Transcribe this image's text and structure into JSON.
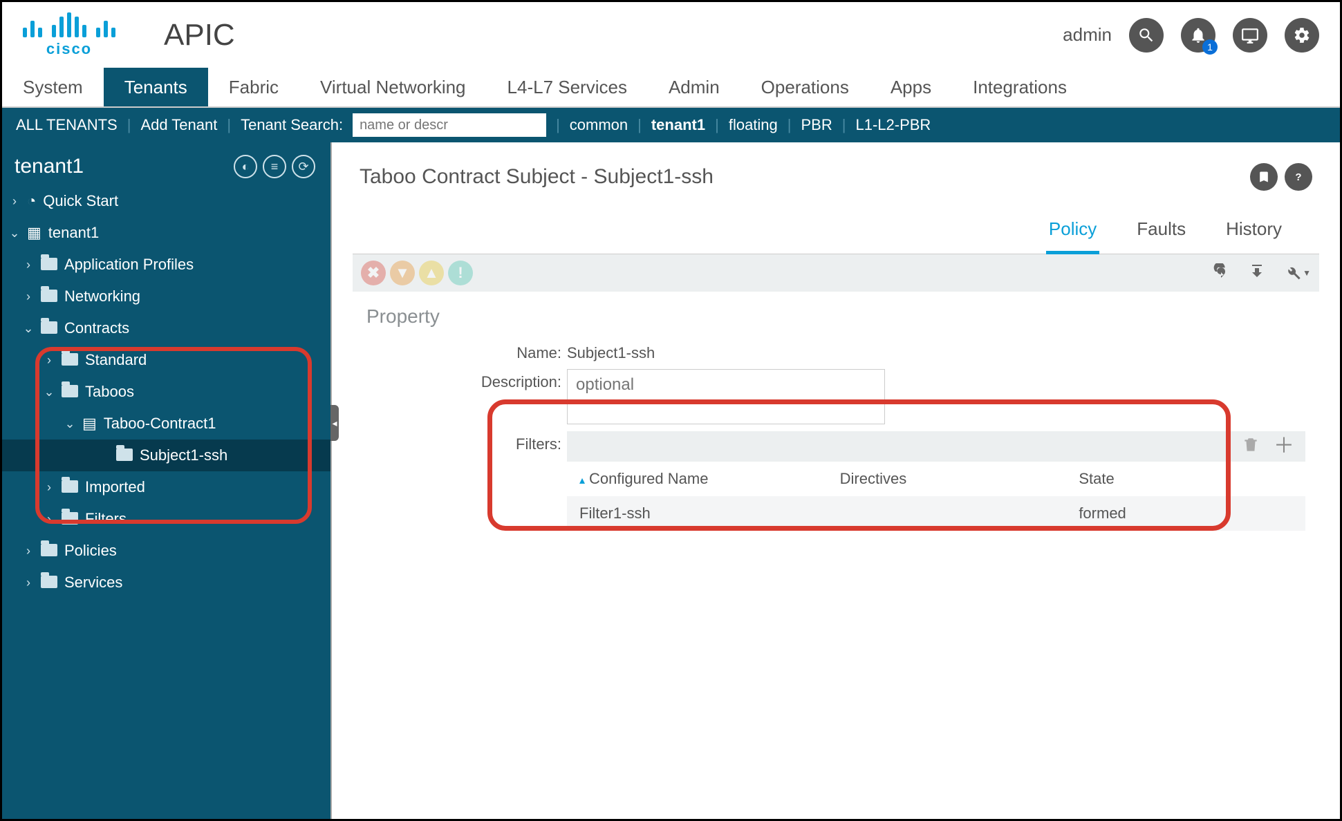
{
  "header": {
    "brand": "cisco",
    "product": "APIC",
    "user": "admin",
    "notif_count": "1"
  },
  "topnav": {
    "items": [
      "System",
      "Tenants",
      "Fabric",
      "Virtual Networking",
      "L4-L7 Services",
      "Admin",
      "Operations",
      "Apps",
      "Integrations"
    ],
    "active_index": 1
  },
  "subbar": {
    "all_tenants": "ALL TENANTS",
    "add_tenant": "Add Tenant",
    "search_label": "Tenant Search:",
    "search_placeholder": "name or descr",
    "links": [
      "common",
      "tenant1",
      "floating",
      "PBR",
      "L1-L2-PBR"
    ],
    "bold_index": 1
  },
  "sidebar": {
    "root": "tenant1",
    "quick_start": "Quick Start",
    "tenant_node": "tenant1",
    "app_profiles": "Application Profiles",
    "networking": "Networking",
    "contracts": "Contracts",
    "standard": "Standard",
    "taboos": "Taboos",
    "taboo_contract": "Taboo-Contract1",
    "subject": "Subject1-ssh",
    "imported": "Imported",
    "filters": "Filters",
    "policies": "Policies",
    "services": "Services"
  },
  "main": {
    "title": "Taboo Contract Subject - Subject1-ssh",
    "tabs": [
      "Policy",
      "Faults",
      "History"
    ],
    "active_tab": 0,
    "property_heading": "Property",
    "name_label": "Name:",
    "name_value": "Subject1-ssh",
    "desc_label": "Description:",
    "desc_placeholder": "optional",
    "filters_label": "Filters:",
    "table": {
      "headers": [
        "Configured Name",
        "Directives",
        "State"
      ],
      "row": {
        "name": "Filter1-ssh",
        "directives": "",
        "state": "formed"
      }
    }
  }
}
